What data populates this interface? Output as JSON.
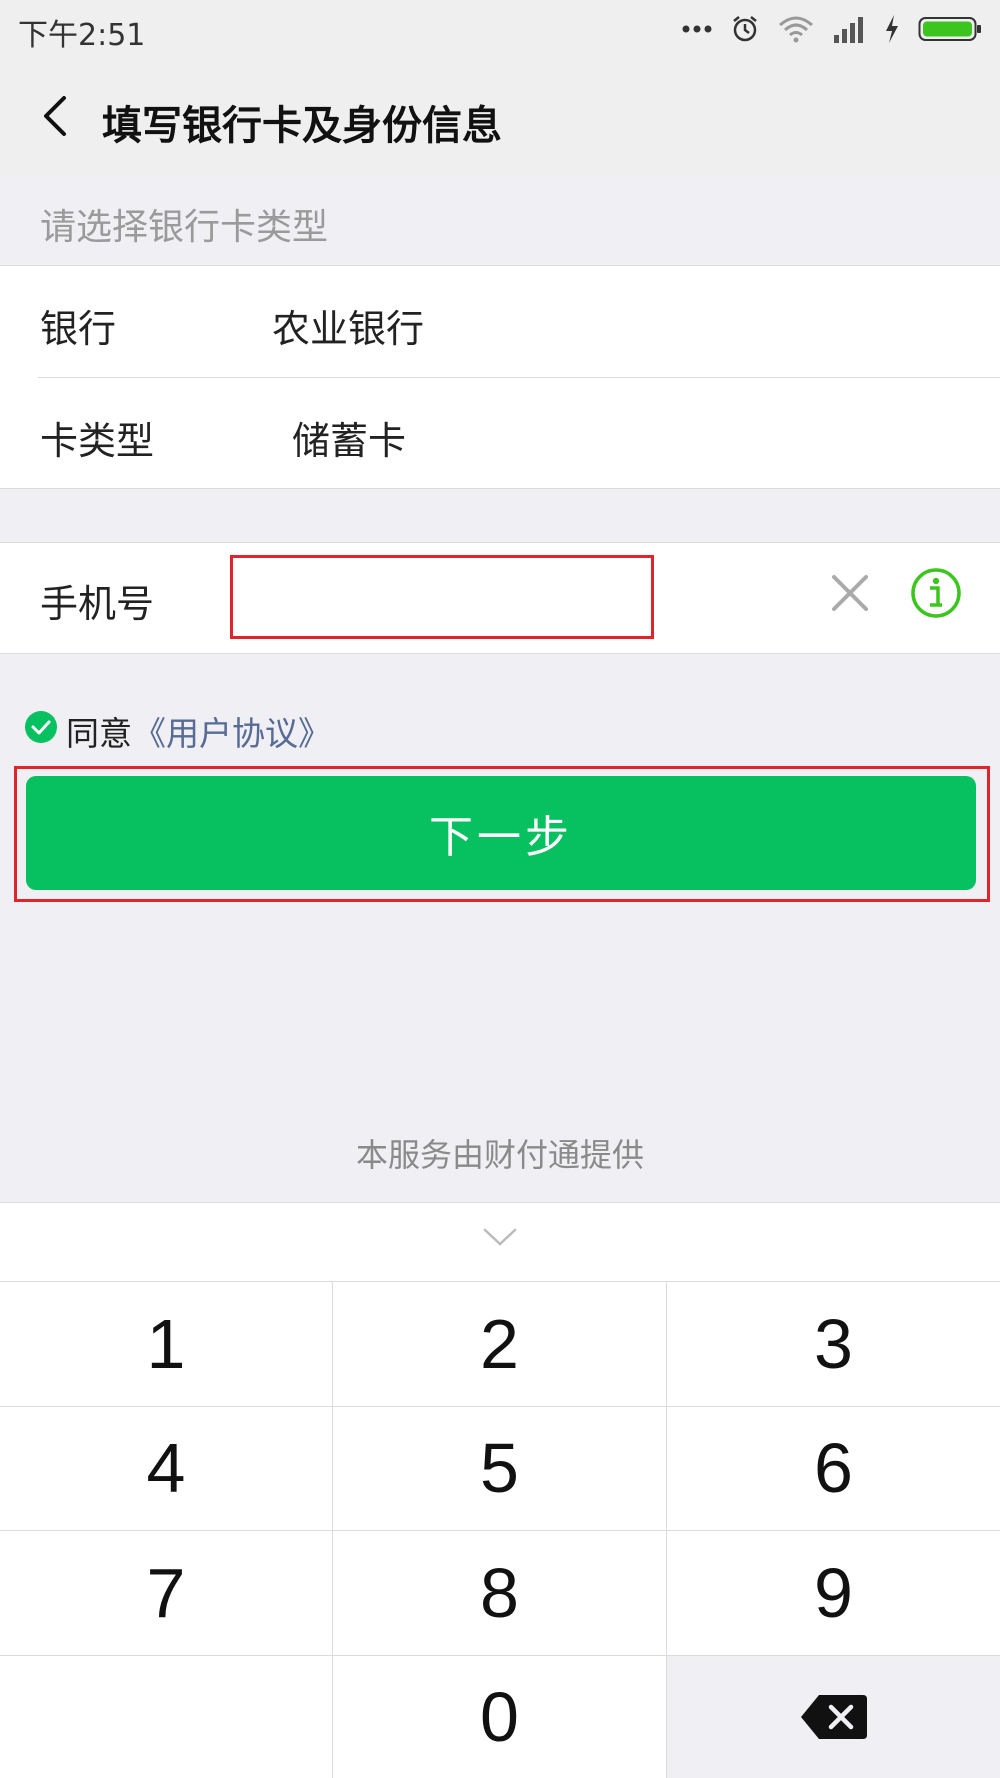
{
  "status_bar": {
    "time": "下午2:51",
    "icons": [
      "more-dots-icon",
      "alarm-icon",
      "wifi-icon",
      "signal-icon",
      "charging-icon",
      "battery-icon"
    ],
    "battery_color": "#3cc51f"
  },
  "header": {
    "title": "填写银行卡及身份信息"
  },
  "card_section": {
    "hint": "请选择银行卡类型",
    "bank_label": "银行",
    "bank_value": "农业银行",
    "card_type_label": "卡类型",
    "card_type_value": "储蓄卡"
  },
  "phone_section": {
    "label": "手机号",
    "value": "",
    "placeholder": ""
  },
  "agreement": {
    "agree_text": "同意",
    "link_text": "《用户协议》"
  },
  "next_button": {
    "label": "下一步"
  },
  "provider": "本服务由财付通提供",
  "keypad": {
    "keys": [
      "1",
      "2",
      "3",
      "4",
      "5",
      "6",
      "7",
      "8",
      "9",
      "",
      "0",
      "delete"
    ]
  },
  "colors": {
    "accent": "#07c160",
    "link": "#576b95",
    "highlight_box": "#e0242b"
  }
}
